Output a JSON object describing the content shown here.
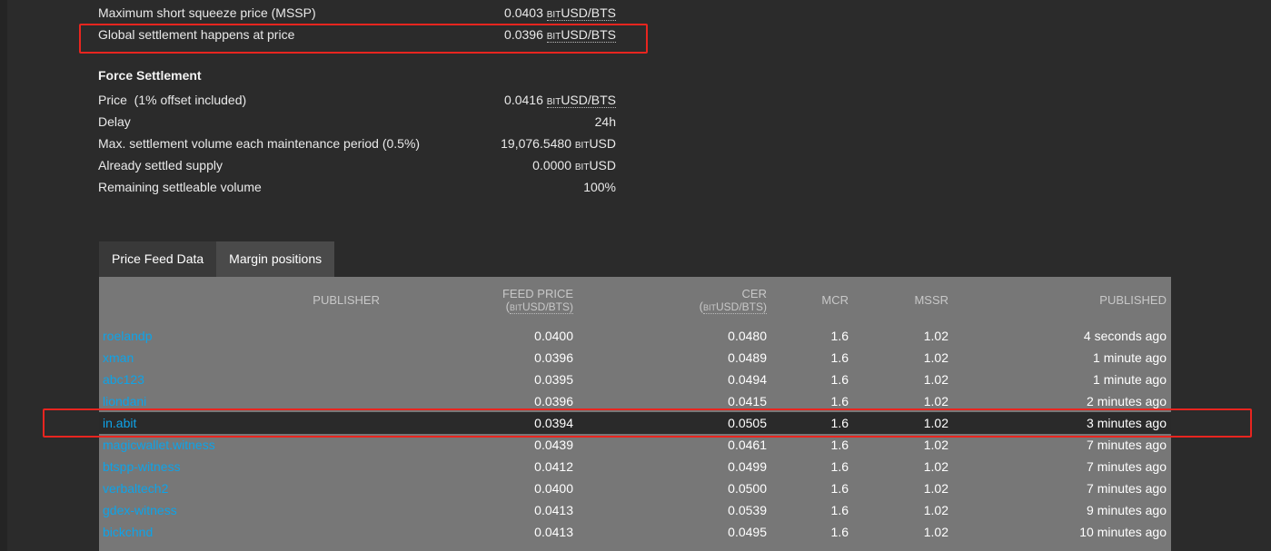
{
  "info": {
    "mssp_label": "Maximum short squeeze price (MSSP)",
    "mssp_value": "0.0403",
    "gs_label": "Global settlement happens at price",
    "gs_value": "0.0396",
    "unit_prefix": "BIT",
    "unit_main": "USD/BTS",
    "unit_usd": "USD"
  },
  "force_settlement": {
    "title": "Force Settlement",
    "price_label": "Price  (1% offset included)",
    "price_value": "0.0416",
    "delay_label": "Delay",
    "delay_value": "24h",
    "maxvol_label": "Max. settlement volume each maintenance period (0.5%)",
    "maxvol_value": "19,076.5480",
    "settled_label": "Already settled supply",
    "settled_value": "0.0000",
    "remaining_label": "Remaining settleable volume",
    "remaining_value": "100%"
  },
  "tabs": [
    {
      "label": "Price Feed Data"
    },
    {
      "label": "Margin positions"
    }
  ],
  "table": {
    "headers": {
      "publisher": "PUBLISHER",
      "feed_price": "FEED PRICE",
      "feed_price_unit_open": "(",
      "feed_price_unit_prefix": "BIT",
      "feed_price_unit_main": "USD/BTS)",
      "cer": "CER",
      "mcr": "MCR",
      "mssr": "MSSR",
      "published": "PUBLISHED"
    },
    "rows": [
      {
        "publisher": "roelandp",
        "feed": "0.0400",
        "cer": "0.0480",
        "mcr": "1.6",
        "mssr": "1.02",
        "published": "4 seconds ago"
      },
      {
        "publisher": "xman",
        "feed": "0.0396",
        "cer": "0.0489",
        "mcr": "1.6",
        "mssr": "1.02",
        "published": "1 minute ago"
      },
      {
        "publisher": "abc123",
        "feed": "0.0395",
        "cer": "0.0494",
        "mcr": "1.6",
        "mssr": "1.02",
        "published": "1 minute ago"
      },
      {
        "publisher": "liondani",
        "feed": "0.0396",
        "cer": "0.0415",
        "mcr": "1.6",
        "mssr": "1.02",
        "published": "2 minutes ago"
      },
      {
        "publisher": "in.abit",
        "feed": "0.0394",
        "cer": "0.0505",
        "mcr": "1.6",
        "mssr": "1.02",
        "published": "3 minutes ago"
      },
      {
        "publisher": "magicwallet.witness",
        "feed": "0.0439",
        "cer": "0.0461",
        "mcr": "1.6",
        "mssr": "1.02",
        "published": "7 minutes ago"
      },
      {
        "publisher": "btspp-witness",
        "feed": "0.0412",
        "cer": "0.0499",
        "mcr": "1.6",
        "mssr": "1.02",
        "published": "7 minutes ago"
      },
      {
        "publisher": "verbaltech2",
        "feed": "0.0400",
        "cer": "0.0500",
        "mcr": "1.6",
        "mssr": "1.02",
        "published": "7 minutes ago"
      },
      {
        "publisher": "gdex-witness",
        "feed": "0.0413",
        "cer": "0.0539",
        "mcr": "1.6",
        "mssr": "1.02",
        "published": "9 minutes ago"
      },
      {
        "publisher": "bickchnd",
        "feed": "0.0413",
        "cer": "0.0495",
        "mcr": "1.6",
        "mssr": "1.02",
        "published": "10 minutes ago"
      }
    ]
  },
  "colors": {
    "background": "#2b2b2b",
    "table_bg": "#777777",
    "highlight_row": "#2a2a2a",
    "link": "#0ea3e8",
    "annotation_red": "#e8251f"
  }
}
